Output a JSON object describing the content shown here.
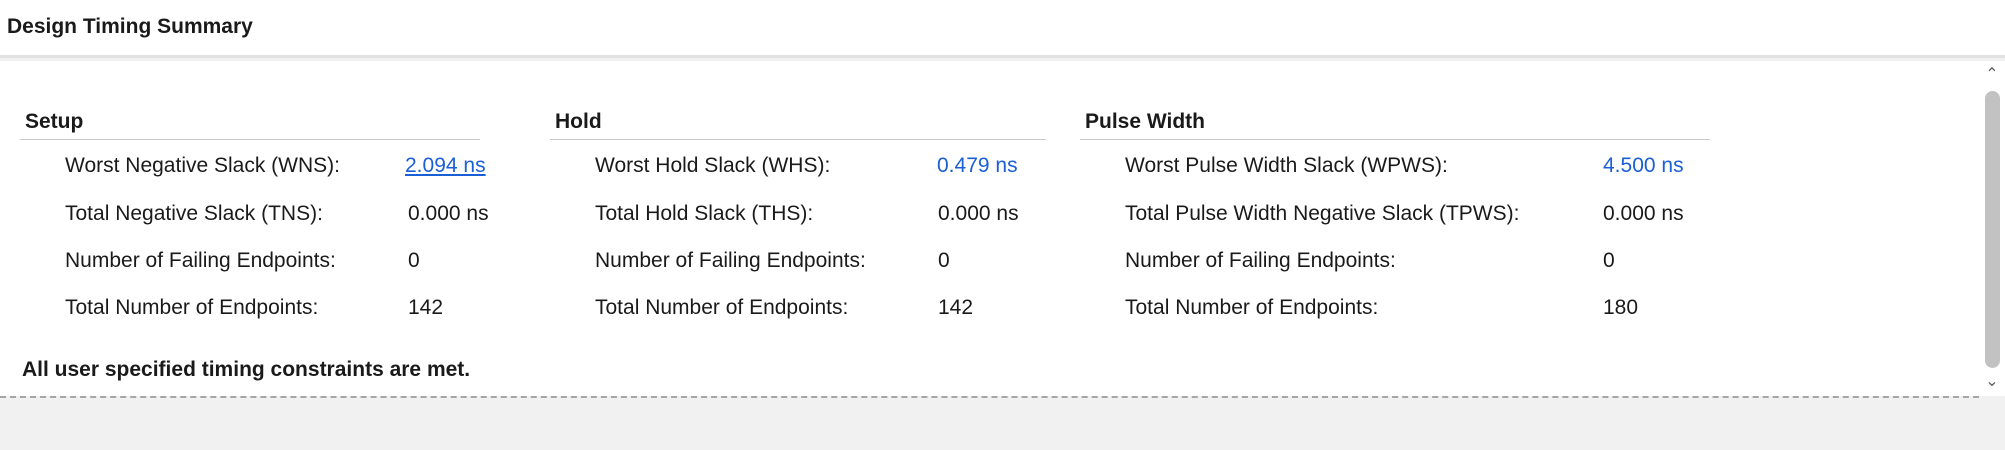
{
  "panel": {
    "title": "Design Timing Summary"
  },
  "sections": [
    {
      "title": "Setup",
      "rows": [
        {
          "label": "Worst Negative Slack (WNS):",
          "value": "2.094 ns"
        },
        {
          "label": "Total Negative Slack (TNS):",
          "value": "0.000 ns"
        },
        {
          "label": "Number of Failing Endpoints:",
          "value": "0"
        },
        {
          "label": "Total Number of Endpoints:",
          "value": "142"
        }
      ]
    },
    {
      "title": "Hold",
      "rows": [
        {
          "label": "Worst Hold Slack (WHS):",
          "value": "0.479 ns"
        },
        {
          "label": "Total Hold Slack (THS):",
          "value": "0.000 ns"
        },
        {
          "label": "Number of Failing Endpoints:",
          "value": "0"
        },
        {
          "label": "Total Number of Endpoints:",
          "value": "142"
        }
      ]
    },
    {
      "title": "Pulse Width",
      "rows": [
        {
          "label": "Worst Pulse Width Slack (WPWS):",
          "value": "4.500 ns"
        },
        {
          "label": "Total Pulse Width Negative Slack (TPWS):",
          "value": "0.000 ns"
        },
        {
          "label": "Number of Failing Endpoints:",
          "value": "0"
        },
        {
          "label": "Total Number of Endpoints:",
          "value": "180"
        }
      ]
    }
  ],
  "status_message": "All user specified timing constraints are met.",
  "colors": {
    "link": "#1a5fd6",
    "divider": "#c8c8c8",
    "background": "#f1f1f1"
  },
  "icons": {
    "scroll_up": "chevron-up-icon",
    "scroll_down": "chevron-down-icon"
  }
}
